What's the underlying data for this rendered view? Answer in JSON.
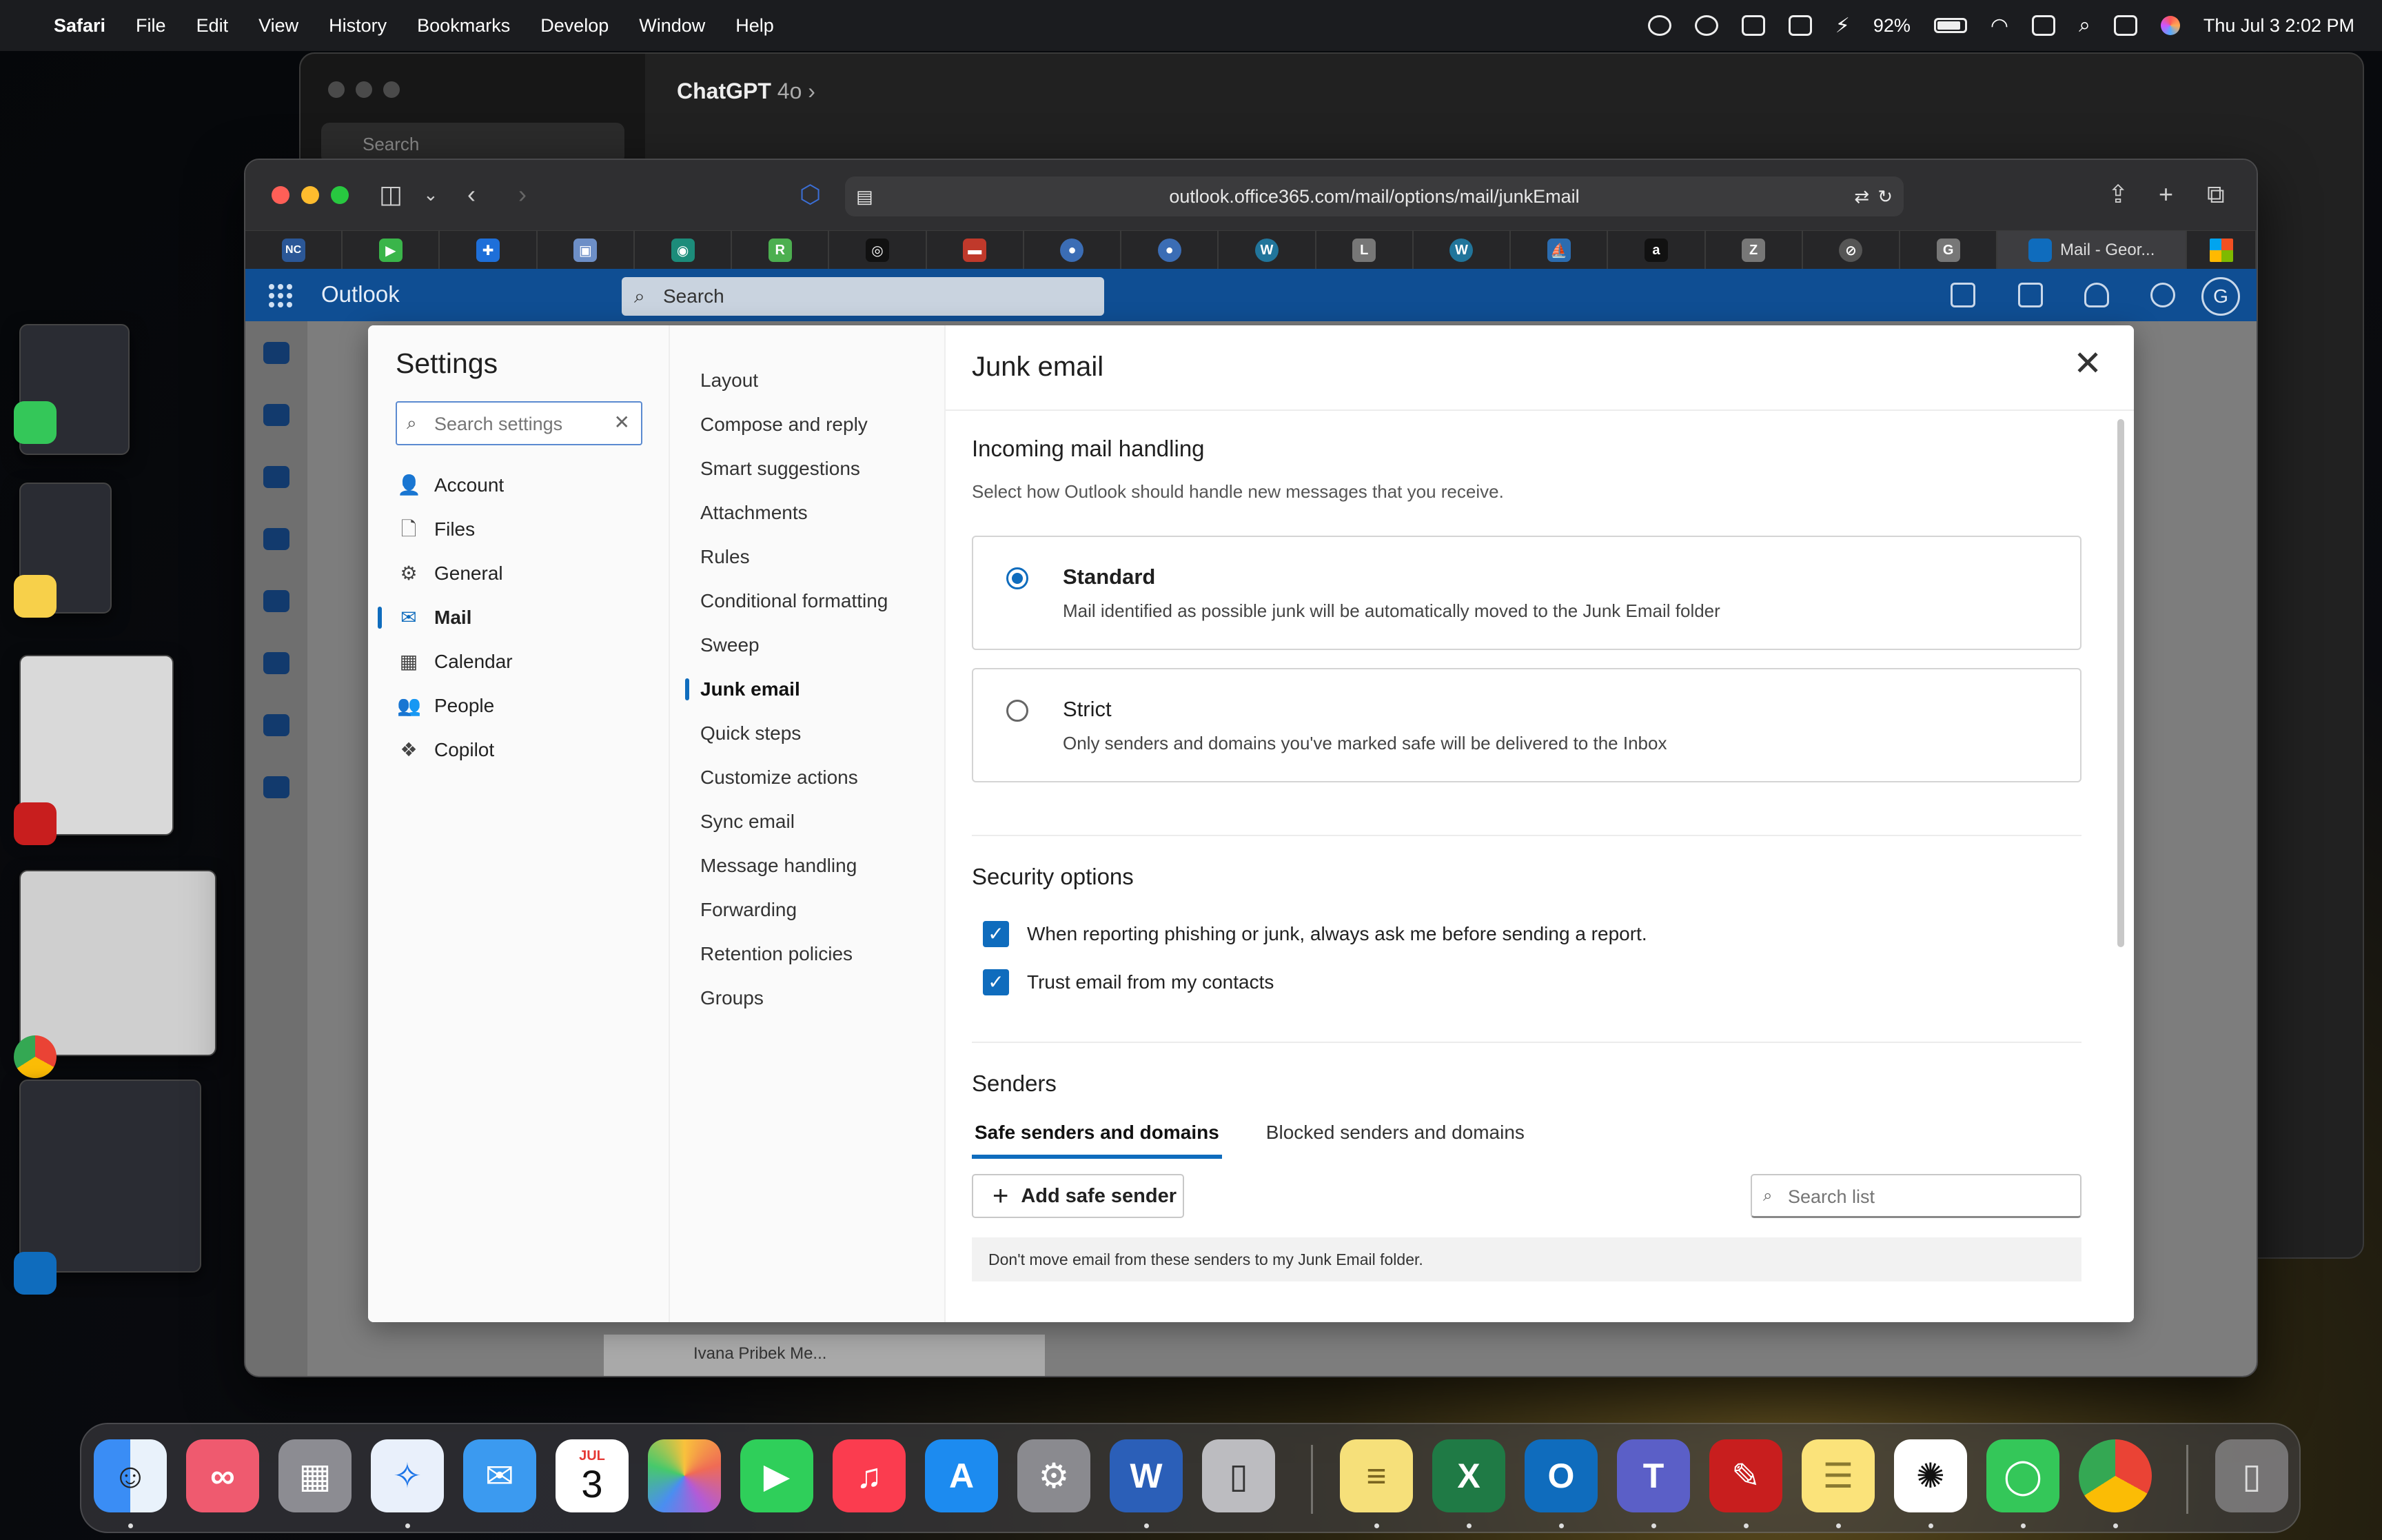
{
  "menubar": {
    "app": "Safari",
    "items": [
      "File",
      "Edit",
      "View",
      "History",
      "Bookmarks",
      "Develop",
      "Window",
      "Help"
    ],
    "battery": "92%",
    "datetime": "Thu Jul 3  2:02 PM"
  },
  "background_window": {
    "title": "ChatGPT",
    "model": "4o",
    "search": "Search"
  },
  "safari": {
    "url": "outlook.office365.com/mail/options/mail/junkEmail",
    "tabs": [
      {
        "icon": "NC",
        "color": "#2b5797"
      },
      {
        "icon": "▶",
        "color": "#3ab54a"
      },
      {
        "icon": "✚",
        "color": "#1e6fd9"
      },
      {
        "icon": "▣",
        "color": "#6d8fc7"
      },
      {
        "icon": "◉",
        "color": "#1c8c7a"
      },
      {
        "icon": "R",
        "color": "#4caf50"
      },
      {
        "icon": "◎",
        "color": "#111111"
      },
      {
        "icon": "▬",
        "color": "#c0392b"
      },
      {
        "icon": "●",
        "color": "#3b6db5"
      },
      {
        "icon": "●",
        "color": "#3b6db5"
      },
      {
        "icon": "W",
        "color": "#21759b"
      },
      {
        "icon": "L",
        "color": "#777777"
      },
      {
        "icon": "W",
        "color": "#21759b"
      },
      {
        "icon": "⛵",
        "color": "#2b6cb0"
      },
      {
        "icon": "a",
        "color": "#111111"
      },
      {
        "icon": "Z",
        "color": "#777777"
      },
      {
        "icon": "⊘",
        "color": "#555555"
      },
      {
        "icon": "G",
        "color": "#777777"
      }
    ],
    "active_tab": "Mail - Geor..."
  },
  "outlook": {
    "brand": "Outlook",
    "search_placeholder": "Search",
    "avatar_initial": "G",
    "under_panel_text": "Ivana Pribek Me..."
  },
  "settings": {
    "title": "Settings",
    "search_placeholder": "Search settings",
    "categories": [
      {
        "label": "Account",
        "icon": "person-icon",
        "glyph": "👤"
      },
      {
        "label": "Files",
        "icon": "file-icon",
        "glyph": "🗋"
      },
      {
        "label": "General",
        "icon": "gear-icon",
        "glyph": "⚙"
      },
      {
        "label": "Mail",
        "icon": "mail-icon",
        "glyph": "✉"
      },
      {
        "label": "Calendar",
        "icon": "calendar-icon",
        "glyph": "▦"
      },
      {
        "label": "People",
        "icon": "people-icon",
        "glyph": "👥"
      },
      {
        "label": "Copilot",
        "icon": "copilot-icon",
        "glyph": "❖"
      }
    ],
    "selected_category": "Mail",
    "subcategories": [
      "Layout",
      "Compose and reply",
      "Smart suggestions",
      "Attachments",
      "Rules",
      "Conditional formatting",
      "Sweep",
      "Junk email",
      "Quick steps",
      "Customize actions",
      "Sync email",
      "Message handling",
      "Forwarding",
      "Retention policies",
      "Groups"
    ],
    "selected_subcategory": "Junk email"
  },
  "junk": {
    "title": "Junk email",
    "incoming": {
      "title": "Incoming mail handling",
      "desc": "Select how Outlook should handle new messages that you receive.",
      "options": [
        {
          "label": "Standard",
          "desc": "Mail identified as possible junk will be automatically moved to the Junk Email folder",
          "selected": true
        },
        {
          "label": "Strict",
          "desc": "Only senders and domains you've marked safe will be delivered to the Inbox",
          "selected": false
        }
      ]
    },
    "security": {
      "title": "Security options",
      "options": [
        {
          "label": "When reporting phishing or junk, always ask me before sending a report.",
          "checked": true
        },
        {
          "label": "Trust email from my contacts",
          "checked": true
        }
      ]
    },
    "senders": {
      "title": "Senders",
      "tabs": [
        "Safe senders and domains",
        "Blocked senders and domains"
      ],
      "selected_tab": "Safe senders and domains",
      "add_button": "Add safe sender",
      "search_placeholder": "Search list",
      "note": "Don't move email from these senders to my Junk Email folder."
    }
  },
  "dock": {
    "calendar_month": "JUL",
    "calendar_day": "3",
    "apps": [
      "Finder",
      "Affinity",
      "Launchpad",
      "Safari",
      "Mail",
      "Calendar",
      "Photos",
      "FaceTime",
      "Music",
      "App Store",
      "System Settings",
      "Word",
      "iPhone Mirroring",
      "Stickies",
      "Excel",
      "Outlook",
      "Teams",
      "Acrobat",
      "Notes",
      "ChatGPT",
      "Messages",
      "Chrome",
      "Trash"
    ]
  },
  "colors": {
    "outlook_header": "#0f4e93",
    "accent": "#0f6cbd"
  }
}
